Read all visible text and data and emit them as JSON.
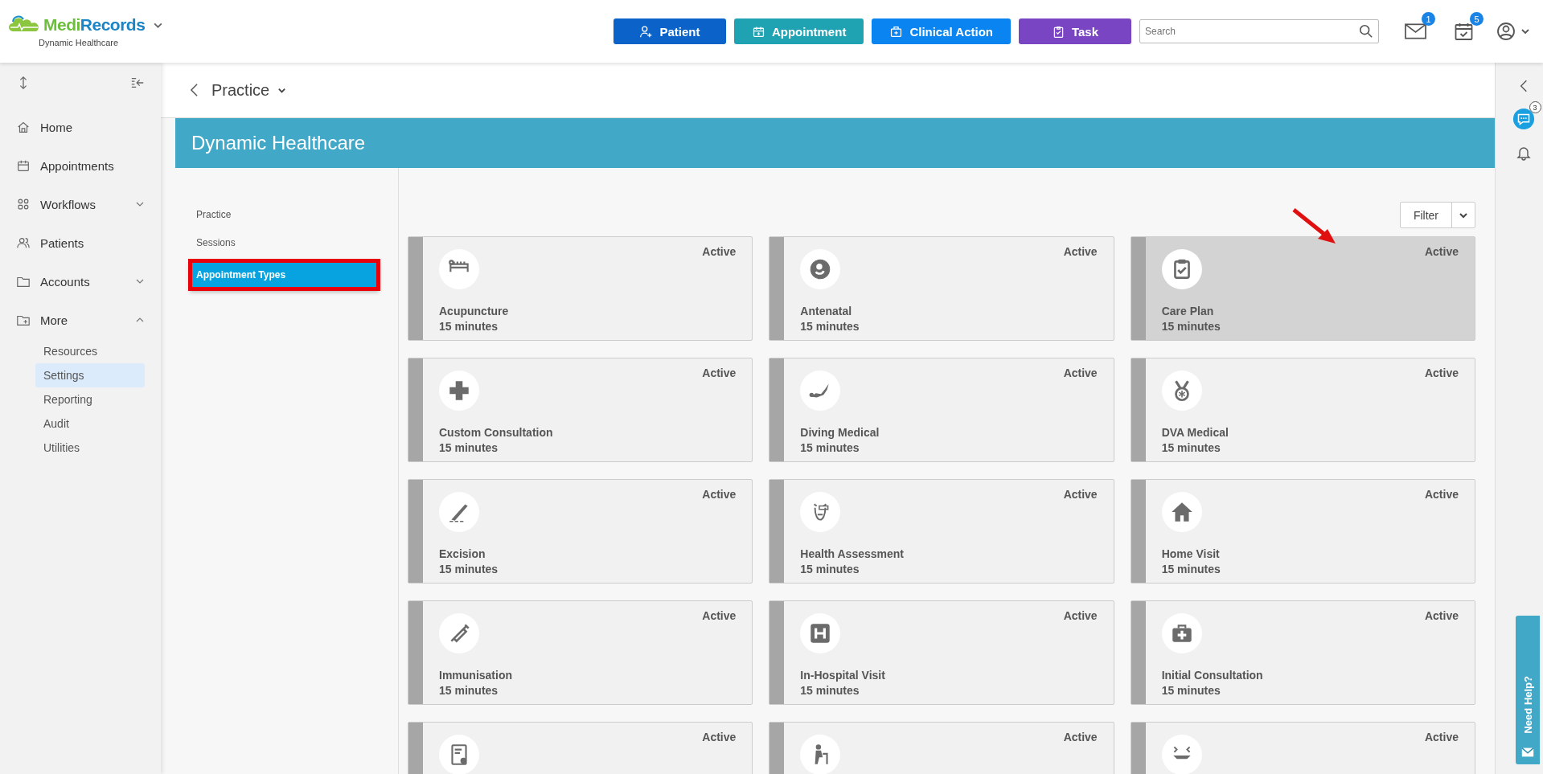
{
  "header": {
    "logo": {
      "brand_first": "Medi",
      "brand_second": "Records",
      "subtitle": "Dynamic Healthcare"
    },
    "actions": [
      {
        "label": "Patient",
        "kind": "patient"
      },
      {
        "label": "Appointment",
        "kind": "appointment"
      },
      {
        "label": "Clinical Action",
        "kind": "clinical"
      },
      {
        "label": "Task",
        "kind": "task"
      }
    ],
    "search": {
      "placeholder": "Search"
    },
    "mail_badge": "1",
    "tasks_badge": "5"
  },
  "sidebar": {
    "items": [
      {
        "label": "Home",
        "kind": "link"
      },
      {
        "label": "Appointments",
        "kind": "link"
      },
      {
        "label": "Workflows",
        "kind": "group",
        "expanded": false
      },
      {
        "label": "Patients",
        "kind": "link"
      },
      {
        "label": "Accounts",
        "kind": "group",
        "expanded": false
      },
      {
        "label": "More",
        "kind": "group",
        "expanded": true,
        "children": [
          {
            "label": "Resources",
            "selected": false
          },
          {
            "label": "Settings",
            "selected": true
          },
          {
            "label": "Reporting",
            "selected": false
          },
          {
            "label": "Audit",
            "selected": false
          },
          {
            "label": "Utilities",
            "selected": false
          }
        ]
      }
    ]
  },
  "page": {
    "title": "Practice",
    "banner": "Dynamic Healthcare",
    "settings_nav": [
      {
        "label": "Practice",
        "selected": false,
        "annotated": false
      },
      {
        "label": "Sessions",
        "selected": false,
        "annotated": false
      },
      {
        "label": "Appointment Types",
        "selected": true,
        "annotated": true
      }
    ],
    "filter": {
      "label": "Filter"
    },
    "cards": [
      {
        "name": "Acupuncture",
        "duration": "15 minutes",
        "status": "Active",
        "hovered": false,
        "annotated": false
      },
      {
        "name": "Antenatal",
        "duration": "15 minutes",
        "status": "Active",
        "hovered": false,
        "annotated": false
      },
      {
        "name": "Care Plan",
        "duration": "15 minutes",
        "status": "Active",
        "hovered": true,
        "annotated": true
      },
      {
        "name": "Custom Consultation",
        "duration": "15 minutes",
        "status": "Active",
        "hovered": false,
        "annotated": false
      },
      {
        "name": "Diving Medical",
        "duration": "15 minutes",
        "status": "Active",
        "hovered": false,
        "annotated": false
      },
      {
        "name": "DVA Medical",
        "duration": "15 minutes",
        "status": "Active",
        "hovered": false,
        "annotated": false
      },
      {
        "name": "Excision",
        "duration": "15 minutes",
        "status": "Active",
        "hovered": false,
        "annotated": false
      },
      {
        "name": "Health Assessment",
        "duration": "15 minutes",
        "status": "Active",
        "hovered": false,
        "annotated": false
      },
      {
        "name": "Home Visit",
        "duration": "15 minutes",
        "status": "Active",
        "hovered": false,
        "annotated": false
      },
      {
        "name": "Immunisation",
        "duration": "15 minutes",
        "status": "Active",
        "hovered": false,
        "annotated": false
      },
      {
        "name": "In-Hospital Visit",
        "duration": "15 minutes",
        "status": "Active",
        "hovered": false,
        "annotated": false
      },
      {
        "name": "Initial Consultation",
        "duration": "15 minutes",
        "status": "Active",
        "hovered": false,
        "annotated": false
      },
      {
        "status": "Active",
        "hovered": false,
        "annotated": false
      },
      {
        "status": "Active",
        "hovered": false,
        "annotated": false
      },
      {
        "status": "Active",
        "hovered": false,
        "annotated": false
      }
    ]
  },
  "right_rail": {
    "chat_badge": "3",
    "help_label": "Need Help?"
  }
}
